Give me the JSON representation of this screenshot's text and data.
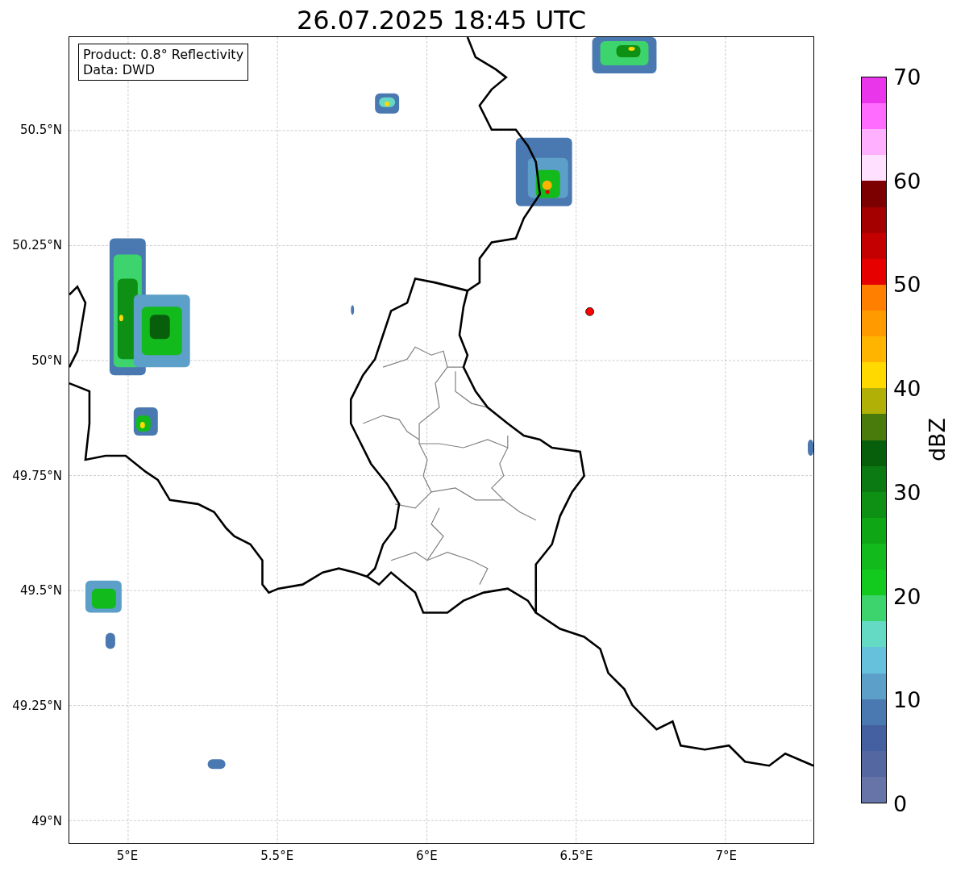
{
  "title": "26.07.2025 18:45 UTC",
  "legend": [
    "Product: 0.8° Reflectivity",
    "Data: DWD"
  ],
  "x_ticks": [
    "5°E",
    "5.5°E",
    "6°E",
    "6.5°E",
    "7°E"
  ],
  "y_ticks": [
    "50.5°N",
    "50.25°N",
    "50°N",
    "49.75°N",
    "49.5°N",
    "49.25°N",
    "49°N"
  ],
  "colorbar": {
    "label": "dBZ",
    "ticks": [
      "70",
      "60",
      "50",
      "40",
      "30",
      "20",
      "10",
      "0"
    ],
    "bands": [
      {
        "color": "#6674a8"
      },
      {
        "color": "#5467a0"
      },
      {
        "color": "#4560a0"
      },
      {
        "color": "#4a78b0"
      },
      {
        "color": "#5c9fc8"
      },
      {
        "color": "#66c2dc"
      },
      {
        "color": "#64d9c4"
      },
      {
        "color": "#3dd46e"
      },
      {
        "color": "#12c91e"
      },
      {
        "color": "#12ba1c"
      },
      {
        "color": "#0fa615"
      },
      {
        "color": "#0d9014"
      },
      {
        "color": "#0b7a12"
      },
      {
        "color": "#075f0c"
      },
      {
        "color": "#497a0c"
      },
      {
        "color": "#b0b007"
      },
      {
        "color": "#ffd900"
      },
      {
        "color": "#ffb400"
      },
      {
        "color": "#ff9a00"
      },
      {
        "color": "#ff7f00"
      },
      {
        "color": "#e60000"
      },
      {
        "color": "#c40000"
      },
      {
        "color": "#a40000"
      },
      {
        "color": "#7d0000"
      },
      {
        "color": "#ffe0ff"
      },
      {
        "color": "#ffb0ff"
      },
      {
        "color": "#ff6cff"
      },
      {
        "color": "#ea36ea"
      }
    ]
  }
}
